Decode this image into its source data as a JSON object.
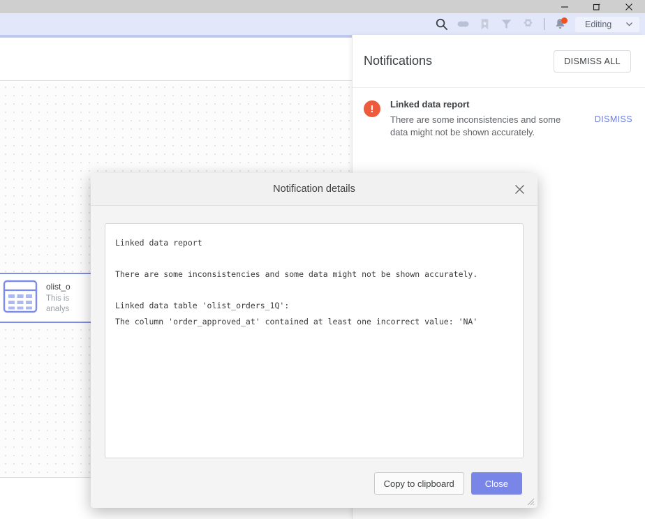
{
  "window": {
    "controls": [
      {
        "name": "minimize",
        "glyph": "minimize-icon"
      },
      {
        "name": "maximize",
        "glyph": "maximize-icon"
      },
      {
        "name": "close",
        "glyph": "close-icon"
      }
    ]
  },
  "toolbar": {
    "icons": [
      {
        "name": "search-icon",
        "label": "Search"
      },
      {
        "name": "comments-icon",
        "label": "Comments"
      },
      {
        "name": "bookmark-icon",
        "label": "Bookmark"
      },
      {
        "name": "filter-icon",
        "label": "Filter"
      },
      {
        "name": "gear-icon",
        "label": "Settings"
      }
    ],
    "notifications_icon": "bell-icon",
    "has_notification_badge": true,
    "badge_color": "#f4511e",
    "mode": {
      "value": "Editing",
      "chevron": "chevron-down-icon"
    }
  },
  "canvas": {
    "dataset_card": {
      "icon": "table-icon",
      "title": "olist_o",
      "description_line1": "This is",
      "description_line2": "analys",
      "selected_border_color": "#7c8ce8"
    }
  },
  "notifications": {
    "title": "Notifications",
    "dismiss_all_label": "DISMISS ALL",
    "items": [
      {
        "severity_icon": "error-icon",
        "severity_color": "#ee5a3c",
        "severity_glyph": "!",
        "title": "Linked data report",
        "description": "There are some inconsistencies and some data might not be shown accurately.",
        "dismiss_label": "DISMISS"
      }
    ]
  },
  "dialog": {
    "title": "Notification details",
    "close_icon": "close-icon",
    "details_text": "Linked data report\n\nThere are some inconsistencies and some data might not be shown accurately.\n\nLinked data table 'olist_orders_1Q':\nThe column 'order_approved_at' contained at least one incorrect value: 'NA'",
    "copy_button_label": "Copy to clipboard",
    "close_button_label": "Close",
    "primary_color": "#7986e8",
    "resize_grip_icon": "resize-grip-icon"
  }
}
